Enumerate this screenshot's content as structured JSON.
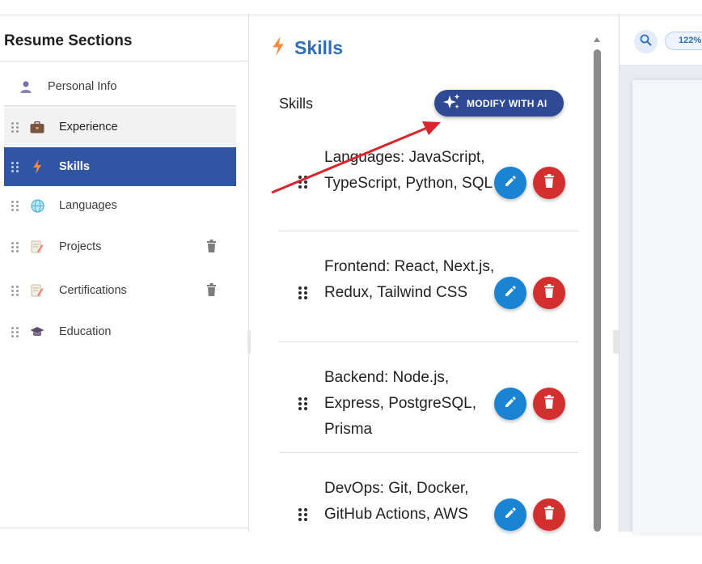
{
  "sidebar": {
    "title": "Resume Sections",
    "items": [
      {
        "label": "Personal Info",
        "icon": "person-icon"
      },
      {
        "label": "Experience",
        "icon": "briefcase-icon"
      },
      {
        "label": "Skills",
        "icon": "lightning-icon",
        "selected": true
      },
      {
        "label": "Languages",
        "icon": "globe-icon"
      },
      {
        "label": "Projects",
        "icon": "document-icon"
      },
      {
        "label": "Certifications",
        "icon": "document-icon"
      },
      {
        "label": "Education",
        "icon": "graduation-cap-icon"
      }
    ]
  },
  "panel": {
    "title": "Skills",
    "section_label": "Skills",
    "ai_button": "MODIFY WITH AI",
    "skills": [
      {
        "text": "Languages: JavaScript, TypeScript, Python, SQL"
      },
      {
        "text": "Frontend: React, Next.js, Redux, Tailwind CSS"
      },
      {
        "text": "Backend: Node.js, Express, PostgreSQL, Prisma"
      },
      {
        "text": "DevOps: Git, Docker, GitHub Actions, AWS"
      }
    ]
  },
  "preview": {
    "zoom": "122%"
  },
  "colors": {
    "selected_bg": "#2f55a4",
    "accent_blue": "#2d6fb6",
    "ai_button_bg": "#2f4a95",
    "edit_button": "#1b84d2",
    "delete_button": "#d32f2f",
    "annotation_arrow": "#d9262c"
  }
}
